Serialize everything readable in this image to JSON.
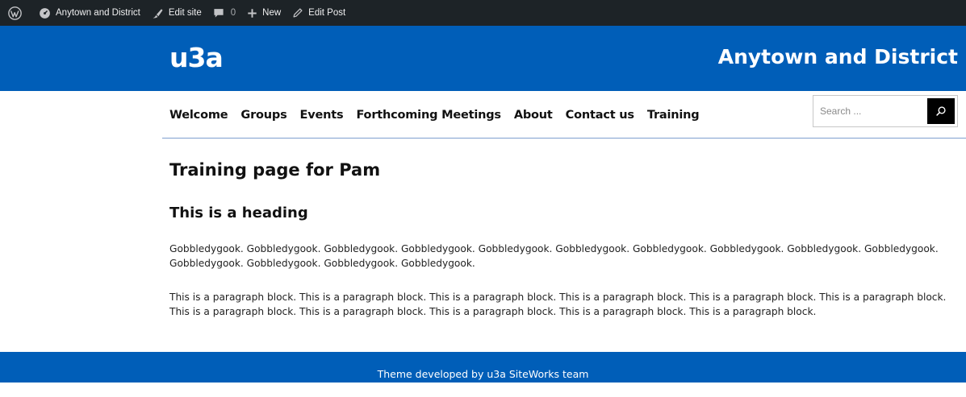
{
  "admin_bar": {
    "site_name": "Anytown and District",
    "edit_site": "Edit site",
    "comments_count": "0",
    "new_label": "New",
    "edit_post": "Edit Post"
  },
  "header": {
    "logo": "u3a",
    "site_title": "Anytown and District"
  },
  "nav": {
    "items": [
      "Welcome",
      "Groups",
      "Events",
      "Forthcoming Meetings",
      "About",
      "Contact us",
      "Training"
    ]
  },
  "search": {
    "placeholder": "Search ..."
  },
  "main": {
    "page_title": "Training page for Pam",
    "heading": "This is a heading",
    "paragraph1": "Gobbledygook. Gobbledygook. Gobbledygook. Gobbledygook. Gobbledygook. Gobbledygook. Gobbledygook. Gobbledygook. Gobbledygook. Gobbledygook. Gobbledygook. Gobbledygook. Gobbledygook. Gobbledygook.",
    "paragraph2": "This is a paragraph block. This is a paragraph block. This is a paragraph block. This is a paragraph block. This is a paragraph block. This is a paragraph block. This is a paragraph block. This is a paragraph block. This is a paragraph block. This is a paragraph block. This is a paragraph block."
  },
  "footer": {
    "credit": "Theme developed by u3a SiteWorks team"
  },
  "colors": {
    "brand_blue": "#005eb8",
    "admin_bar": "#1d2327"
  }
}
